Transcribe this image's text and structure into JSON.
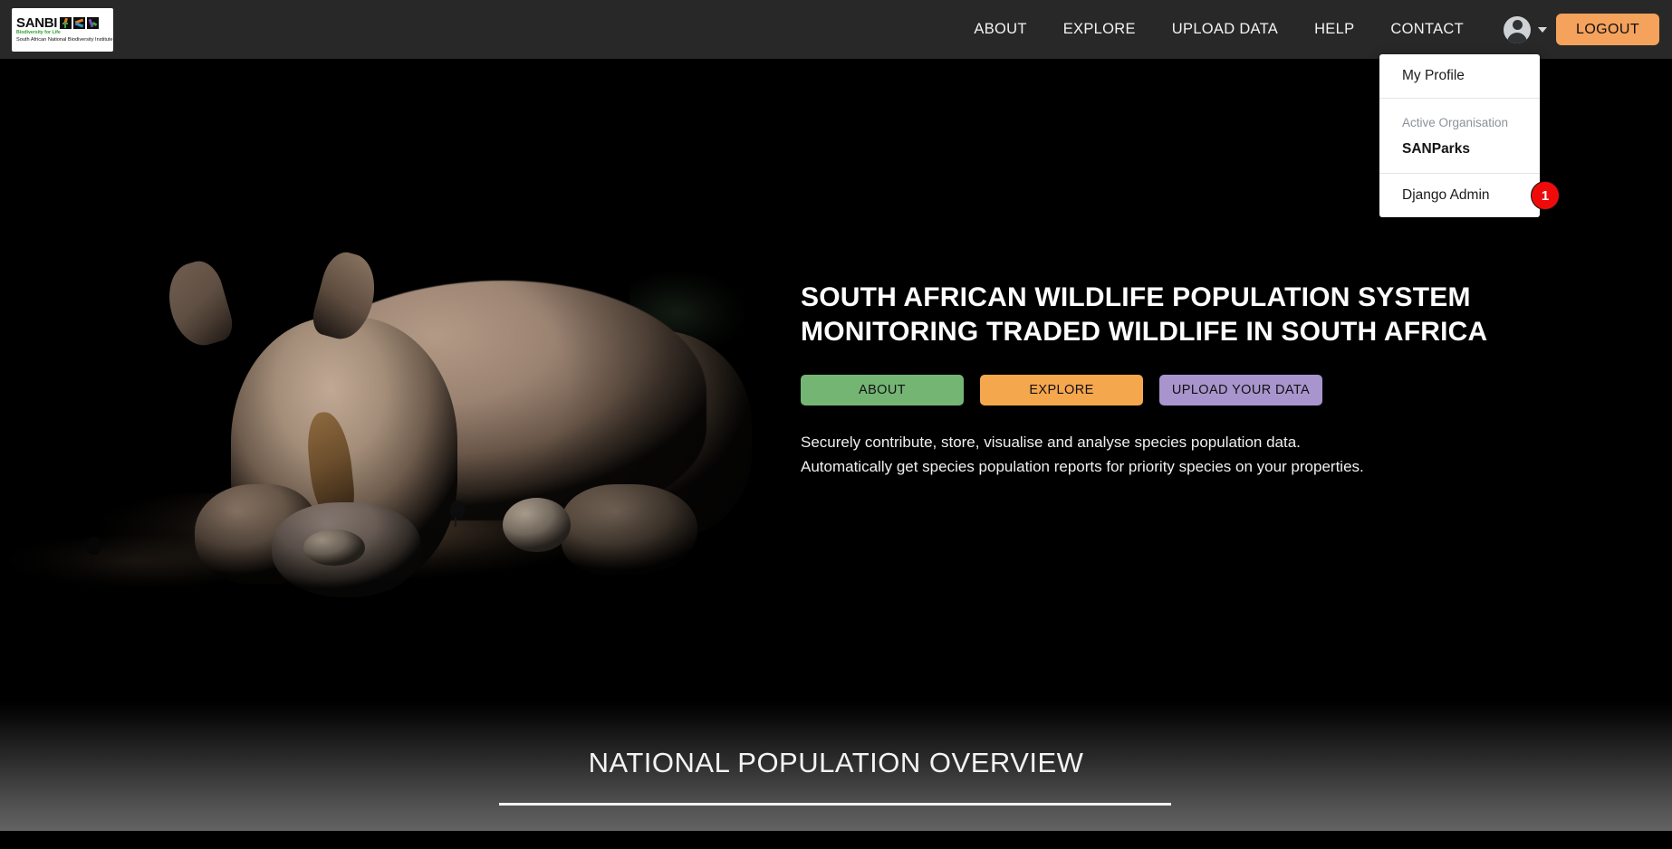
{
  "brand": {
    "name": "SANBI",
    "tagline": "Biodiversity for Life",
    "full_name": "South African National Biodiversity Institute"
  },
  "nav": {
    "links": [
      {
        "label": "ABOUT"
      },
      {
        "label": "EXPLORE"
      },
      {
        "label": "UPLOAD DATA"
      },
      {
        "label": "HELP"
      },
      {
        "label": "CONTACT"
      }
    ],
    "avatar_icon": "user-avatar-icon",
    "caret_icon": "chevron-down-icon",
    "logout_label": "LOGOUT"
  },
  "user_menu": {
    "profile_label": "My Profile",
    "organisation_label": "Active Organisation",
    "organisation_value": "SANParks",
    "admin_label": "Django Admin",
    "admin_badge": "1"
  },
  "hero": {
    "title_line1": "SOUTH AFRICAN WILDLIFE POPULATION SYSTEM",
    "title_line2": "MONITORING TRADED WILDLIFE IN SOUTH AFRICA",
    "cta": [
      {
        "label": "ABOUT",
        "color": "#74b573"
      },
      {
        "label": "EXPLORE",
        "color": "#f5a74e"
      },
      {
        "label": "UPLOAD YOUR DATA",
        "color": "#a895cd"
      }
    ],
    "paragraph_line1": "Securely contribute, store, visualise and analyse species population data.",
    "paragraph_line2": "Automatically get species population reports for priority species on your properties.",
    "photo_alt": "rhinoceros-resting-in-dark-scene"
  },
  "overview": {
    "title": "NATIONAL POPULATION OVERVIEW"
  },
  "colors": {
    "header_bg": "#282828",
    "page_bg": "#000000",
    "accent_orange": "#f5a25d",
    "badge_red": "#f00b0b",
    "menu_bg": "#ffffff"
  }
}
